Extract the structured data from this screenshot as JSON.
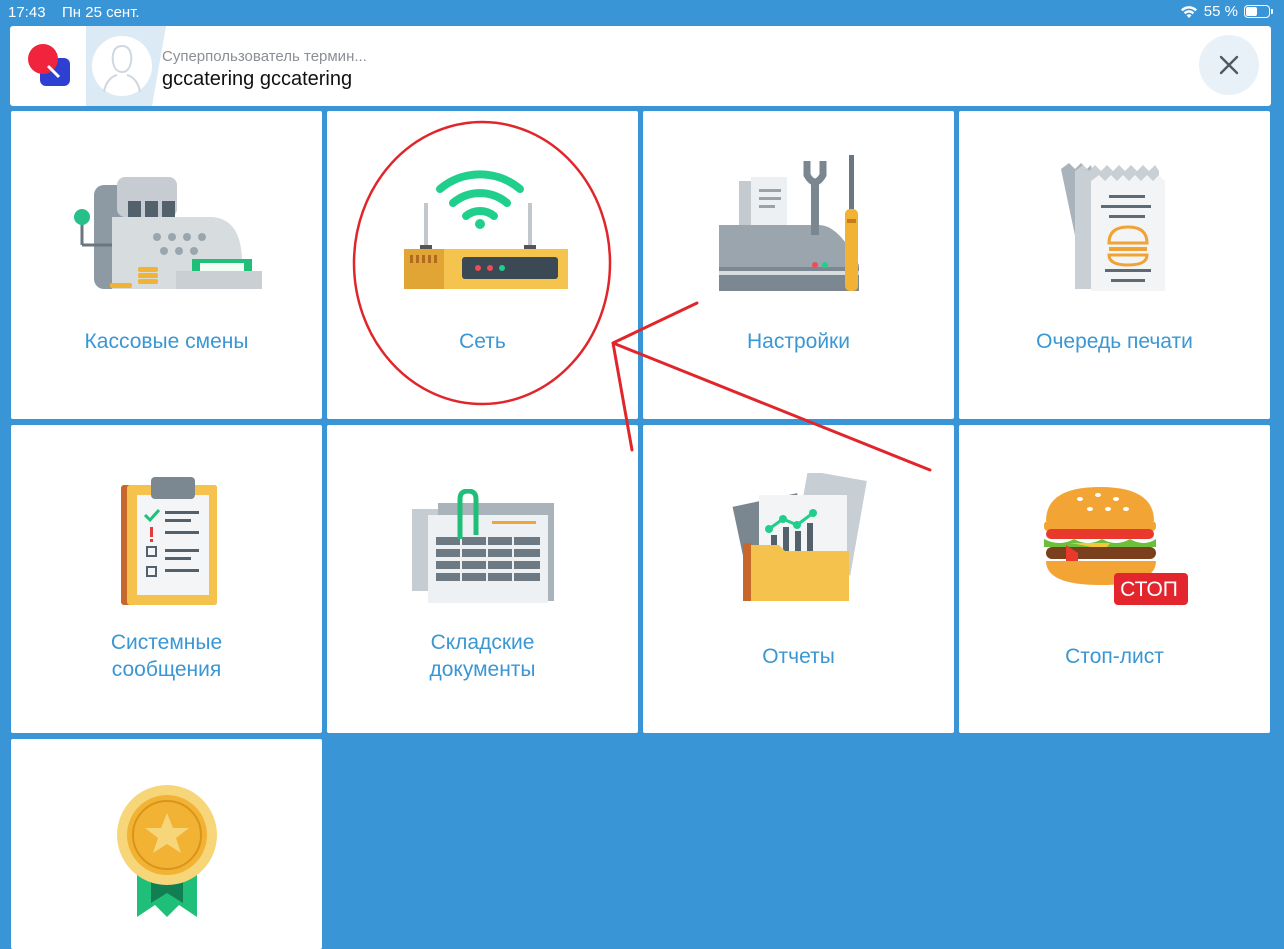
{
  "status_bar": {
    "time": "17:43",
    "date": "Пн 25 сент.",
    "battery": "55 %"
  },
  "header": {
    "role": "Суперпользователь термин...",
    "user_name": "gccatering gccatering"
  },
  "tiles": [
    {
      "label": "Кассовые смены",
      "icon": "cash-register-icon"
    },
    {
      "label": "Сеть",
      "icon": "router-icon"
    },
    {
      "label": "Настройки",
      "icon": "tools-printer-icon"
    },
    {
      "label": "Очередь печати",
      "icon": "receipts-icon"
    },
    {
      "label": "Системные\nсообщения",
      "icon": "clipboard-icon"
    },
    {
      "label": "Складские\nдокументы",
      "icon": "documents-icon"
    },
    {
      "label": "Отчеты",
      "icon": "reports-folder-icon"
    },
    {
      "label": "Стоп-лист",
      "icon": "burger-stop-icon",
      "badge": "СТОП"
    },
    {
      "label": "",
      "icon": "medal-icon"
    }
  ],
  "colors": {
    "background": "#3a95d6",
    "tile_label": "#3a97d4",
    "annotation": "#e0262b"
  }
}
